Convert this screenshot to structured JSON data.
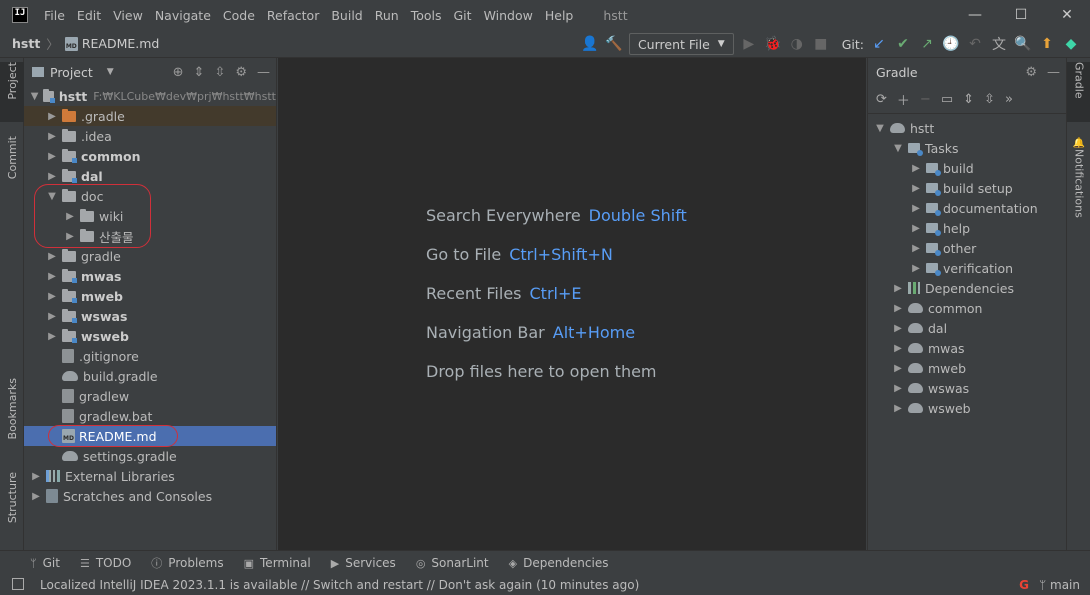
{
  "window": {
    "title": "hstt",
    "menu": [
      "File",
      "Edit",
      "View",
      "Navigate",
      "Code",
      "Refactor",
      "Build",
      "Run",
      "Tools",
      "Git",
      "Window",
      "Help"
    ],
    "controls": {
      "minimize": "—",
      "maximize": "☐",
      "close": "✕"
    }
  },
  "navbar": {
    "project": "hstt",
    "file": "README.md",
    "run_config": "Current File",
    "git_label": "Git:"
  },
  "left_tools": {
    "project": "Project",
    "commit": "Commit",
    "bookmarks": "Bookmarks",
    "structure": "Structure"
  },
  "right_tools": {
    "gradle": "Gradle",
    "notifications": "Notifications"
  },
  "project_panel": {
    "title": "Project",
    "root": {
      "name": "hstt",
      "path": "F:₩KLCube₩dev₩prj₩hstt₩hstt"
    },
    "items": [
      {
        "label": ".gradle"
      },
      {
        "label": ".idea"
      },
      {
        "label": "common"
      },
      {
        "label": "dal"
      },
      {
        "label": "doc"
      },
      {
        "label": "wiki"
      },
      {
        "label": "산출물"
      },
      {
        "label": "gradle"
      },
      {
        "label": "mwas"
      },
      {
        "label": "mweb"
      },
      {
        "label": "wswas"
      },
      {
        "label": "wsweb"
      },
      {
        "label": ".gitignore"
      },
      {
        "label": "build.gradle"
      },
      {
        "label": "gradlew"
      },
      {
        "label": "gradlew.bat"
      },
      {
        "label": "README.md"
      },
      {
        "label": "settings.gradle"
      },
      {
        "label": "External Libraries"
      },
      {
        "label": "Scratches and Consoles"
      }
    ]
  },
  "editor": {
    "hints": [
      {
        "label": "Search Everywhere",
        "key": "Double Shift"
      },
      {
        "label": "Go to File",
        "key": "Ctrl+Shift+N"
      },
      {
        "label": "Recent Files",
        "key": "Ctrl+E"
      },
      {
        "label": "Navigation Bar",
        "key": "Alt+Home"
      },
      {
        "label": "Drop files here to open them",
        "key": ""
      }
    ]
  },
  "gradle_panel": {
    "title": "Gradle",
    "root": "hstt",
    "tasks_label": "Tasks",
    "tasks": [
      "build",
      "build setup",
      "documentation",
      "help",
      "other",
      "verification"
    ],
    "dependencies": "Dependencies",
    "modules": [
      "common",
      "dal",
      "mwas",
      "mweb",
      "wswas",
      "wsweb"
    ]
  },
  "bottom_tabs": [
    "Git",
    "TODO",
    "Problems",
    "Terminal",
    "Services",
    "SonarLint",
    "Dependencies"
  ],
  "status": {
    "message": "Localized IntelliJ IDEA 2023.1.1 is available // Switch and restart // Don't ask again (10 minutes ago)",
    "branch": "main"
  },
  "colors": {
    "editor_bg": "#2b2b2b",
    "panel_bg": "#3c3f41",
    "selection": "#4b6eaf",
    "link": "#589df6",
    "annotation": "#d0303a"
  }
}
